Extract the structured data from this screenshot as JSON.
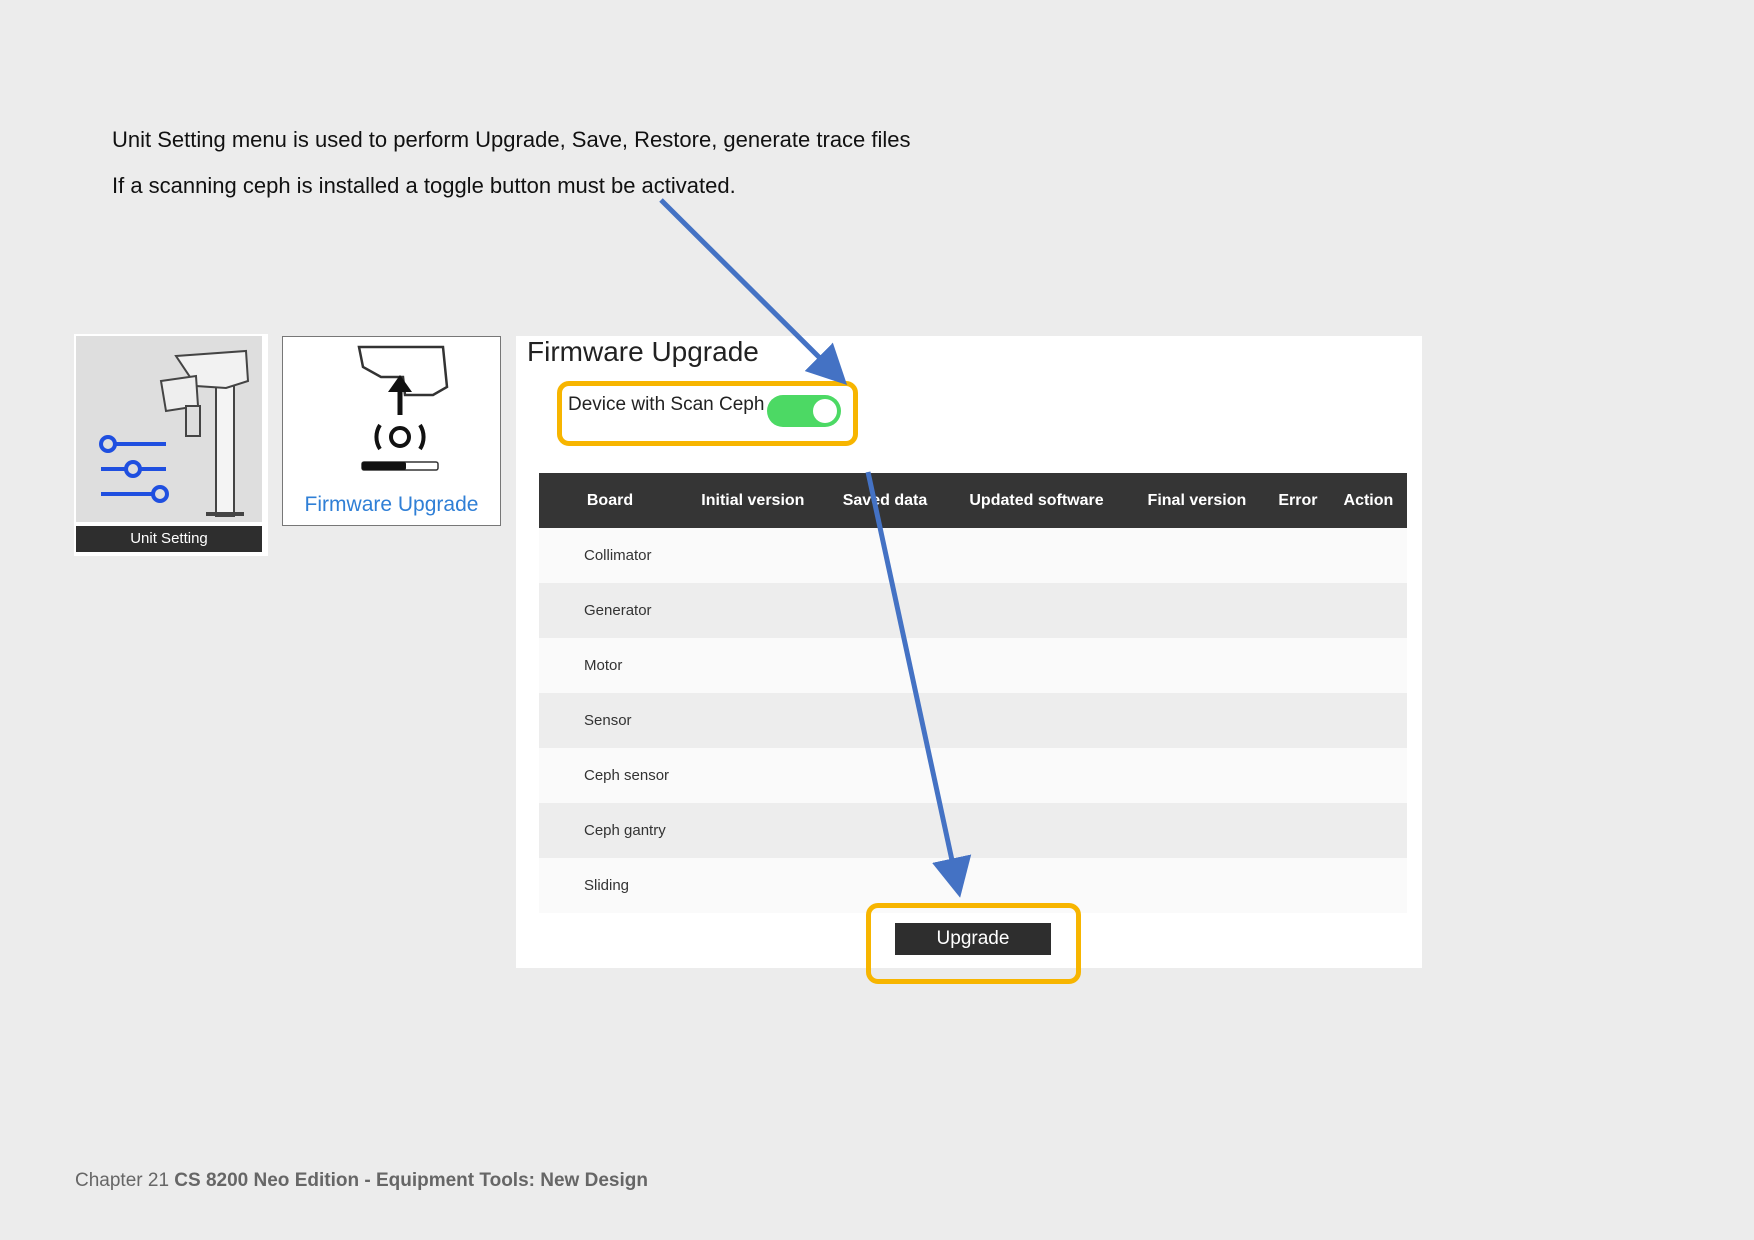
{
  "intro": {
    "line1": "Unit Setting menu is used to perform Upgrade, Save, Restore, generate trace files",
    "line2": "If a scanning ceph is installed a toggle button must be activated."
  },
  "tiles": {
    "unit_setting_label": "Unit Setting",
    "firmware_label": "Firmware Upgrade"
  },
  "panel": {
    "title": "Firmware Upgrade",
    "toggle_label": "Device with Scan Ceph",
    "toggle_on": true,
    "columns": [
      "Board",
      "Initial version",
      "Saved data",
      "Updated software",
      "Final version",
      "Error",
      "Action"
    ],
    "boards": [
      "Collimator",
      "Generator",
      "Motor",
      "Sensor",
      "Ceph sensor",
      "Ceph gantry",
      "Sliding"
    ],
    "upgrade_label": "Upgrade"
  },
  "footer": {
    "chapter": "Chapter 21",
    "title": "CS 8200 Neo Edition - Equipment Tools: New Design"
  },
  "colors": {
    "highlight": "#f7b500",
    "arrow": "#4472c4",
    "toggle_on": "#4cd964",
    "tile_link": "#2f7fd6",
    "slider_icon": "#1f4fe0"
  }
}
